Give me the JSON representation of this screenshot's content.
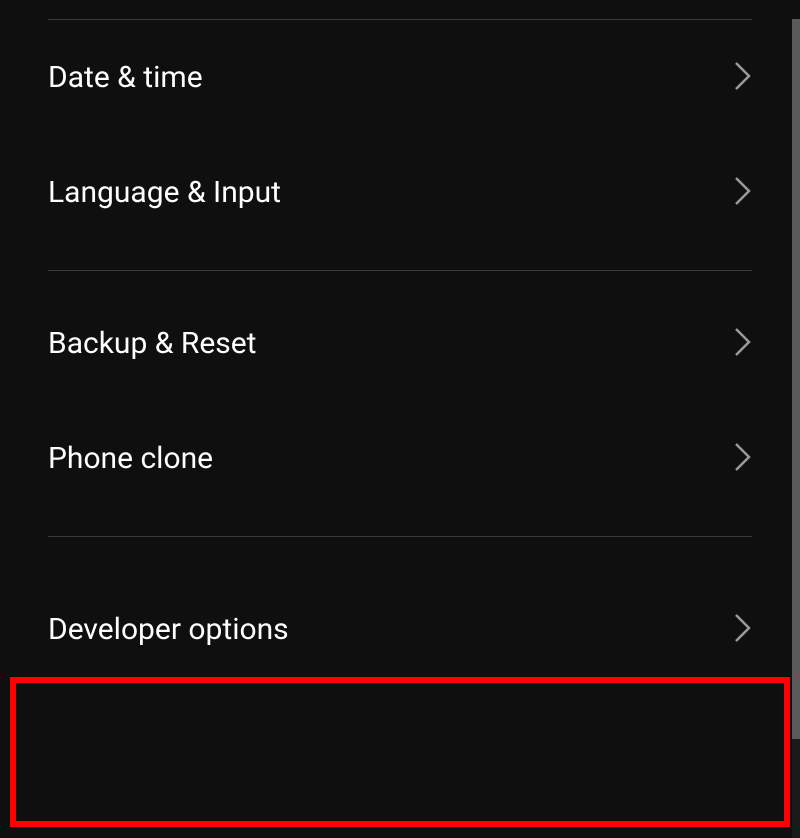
{
  "groups": [
    {
      "items": [
        {
          "id": "date-time",
          "label": "Date & time"
        },
        {
          "id": "language-input",
          "label": "Language & Input"
        }
      ]
    },
    {
      "items": [
        {
          "id": "backup-reset",
          "label": "Backup & Reset"
        },
        {
          "id": "phone-clone",
          "label": "Phone clone"
        }
      ]
    },
    {
      "items": [
        {
          "id": "developer-options",
          "label": "Developer options"
        }
      ]
    }
  ],
  "highlighted_item_id": "developer-options",
  "colors": {
    "background": "#0f0f0f",
    "text": "#ffffff",
    "chevron": "#9a9a9a",
    "divider": "#3a3a3a",
    "highlight": "#ff0000"
  }
}
